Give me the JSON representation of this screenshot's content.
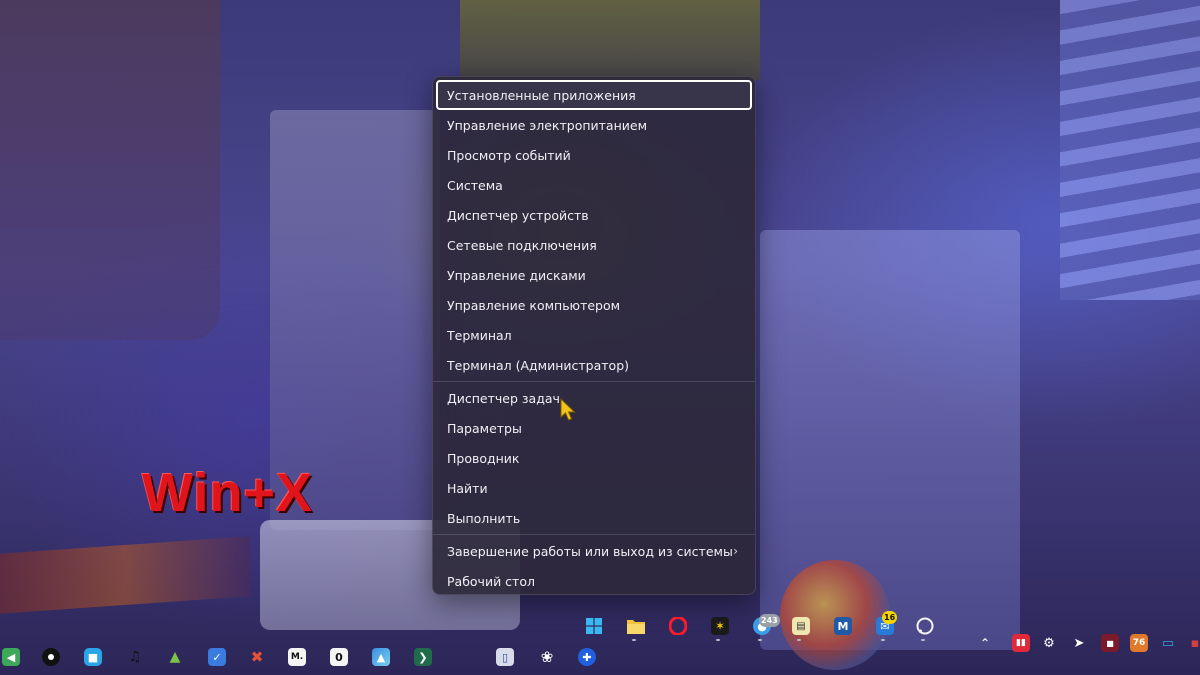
{
  "overlay": {
    "hotkey": "Win+X"
  },
  "context_menu": {
    "items": [
      {
        "label": "Установленные приложения",
        "focused": true
      },
      {
        "label": "Управление электропитанием"
      },
      {
        "label": "Просмотр событий"
      },
      {
        "label": "Система"
      },
      {
        "label": "Диспетчер устройств"
      },
      {
        "label": "Сетевые подключения"
      },
      {
        "label": "Управление дисками"
      },
      {
        "label": "Управление компьютером"
      },
      {
        "label": "Терминал"
      },
      {
        "label": "Терминал (Администратор)"
      },
      {
        "label": "Диспетчер задач"
      },
      {
        "label": "Параметры"
      },
      {
        "label": "Проводник"
      },
      {
        "label": "Найти"
      },
      {
        "label": "Выполнить"
      },
      {
        "label": "Завершение работы или выход из системы",
        "has_submenu": true
      },
      {
        "label": "Рабочий стол"
      }
    ],
    "submenu_icon": "chevron-right-icon"
  },
  "taskbar": {
    "pinned": [
      {
        "icon": "windows-start-icon"
      },
      {
        "icon": "file-explorer-icon"
      },
      {
        "icon": "opera-icon"
      },
      {
        "icon": "star-app-icon"
      },
      {
        "icon": "chat-app-icon",
        "badge": "243"
      },
      {
        "icon": "notes-app-icon"
      },
      {
        "icon": "m-app-icon"
      },
      {
        "icon": "mail-app-icon",
        "badge": "16"
      },
      {
        "icon": "whatsapp-icon"
      }
    ],
    "left_apps": [
      {
        "icon": "android-mirror-icon"
      },
      {
        "icon": "record-icon"
      },
      {
        "icon": "chat-bubble-icon"
      },
      {
        "icon": "music-icon"
      },
      {
        "icon": "android-icon"
      },
      {
        "icon": "todo-icon"
      },
      {
        "icon": "tools-icon"
      },
      {
        "icon": "m-app-icon",
        "label": "M."
      },
      {
        "icon": "zero-app-icon",
        "label": "0"
      },
      {
        "icon": "photos-icon"
      },
      {
        "icon": "terminal-icon"
      },
      {
        "icon": "phone-link-icon"
      },
      {
        "icon": "chatgpt-icon"
      },
      {
        "icon": "game-controller-icon"
      }
    ],
    "tray": [
      {
        "icon": "chevron-up-icon"
      },
      {
        "icon": "audio-meter-icon"
      },
      {
        "icon": "steam-icon"
      },
      {
        "icon": "telegram-icon"
      },
      {
        "icon": "tray-app-icon"
      },
      {
        "icon": "weather-icon",
        "label": "76"
      },
      {
        "icon": "display-icon"
      },
      {
        "icon": "notification-icon"
      }
    ]
  },
  "colors": {
    "menu_bg": "#2c283a",
    "menu_text": "#f1f0f6",
    "hotkey_red": "#e0141b",
    "badge_yellow": "#f5d400"
  }
}
